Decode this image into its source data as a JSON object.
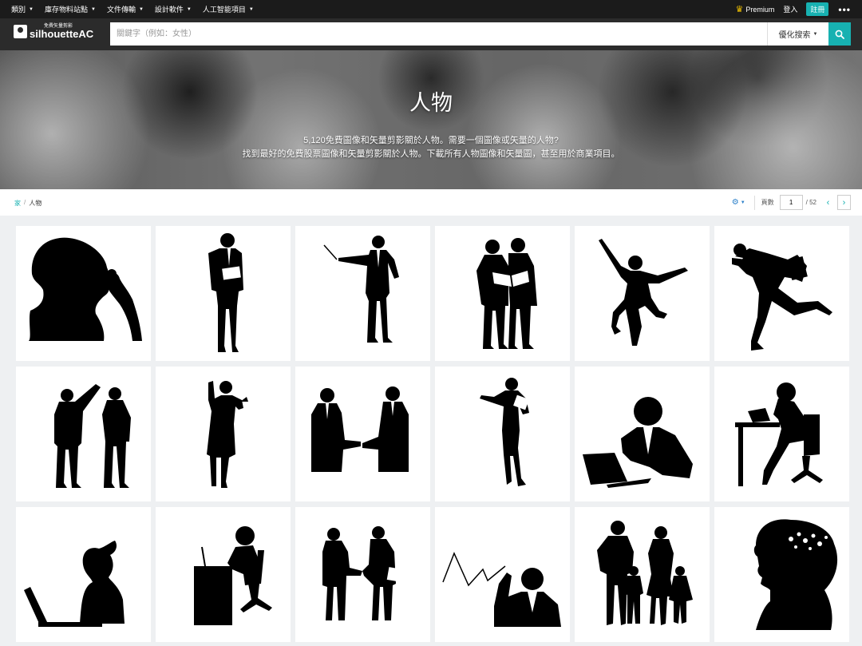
{
  "topbar": {
    "nav": [
      "類別",
      "庫存物料站點",
      "文件傳輸",
      "設計軟件",
      "人工智能項目"
    ],
    "premium": "Premium",
    "login": "登入",
    "register": "註冊",
    "more": "•••"
  },
  "header": {
    "logo_sub": "免費矢量剪影",
    "logo_main": "silhouetteAC",
    "search_placeholder": "關鍵字（例如：女性）",
    "search_option": "優化搜索"
  },
  "banner": {
    "title": "人物",
    "line1": "5,120免費圖像和矢量剪影關於人物。需要一個圖像或矢量的人物?",
    "line2": "找到最好的免費股票圖像和矢量剪影關於人物。下載所有人物圖像和矢量圖，甚至用於商業項目。"
  },
  "breadcrumb": {
    "home": "家",
    "separator": "/",
    "current": "人物"
  },
  "pager": {
    "label": "頁數",
    "current_page": "1",
    "total": "/ 52"
  },
  "icons": {
    "crown": "crown-icon",
    "search": "search-icon",
    "gear": "gear-icon",
    "prev": "chevron-left-icon",
    "next": "chevron-right-icon"
  },
  "colors": {
    "accent": "#17b1b1",
    "topbar": "#1b1b1b",
    "header": "#2b2b2b",
    "card": "#ffffff",
    "silhouette": "#000000"
  },
  "thumbnails": [
    "woman-head-profile-thinking",
    "businessman-holding-document",
    "businessman-pointing-stick",
    "two-workers-reading-document",
    "woman-jumping-joy",
    "businessman-running-phone",
    "two-workers-pointing",
    "businesswoman-cheering",
    "businessmen-handshake",
    "businesswoman-presenting",
    "man-laptop-desk",
    "woman-phone-desk-chair",
    "woman-laptop-profile",
    "operator-headset-desk",
    "businessmen-handshake-2",
    "businessman-chart-fist",
    "family-walking",
    "woman-head-flowers"
  ]
}
